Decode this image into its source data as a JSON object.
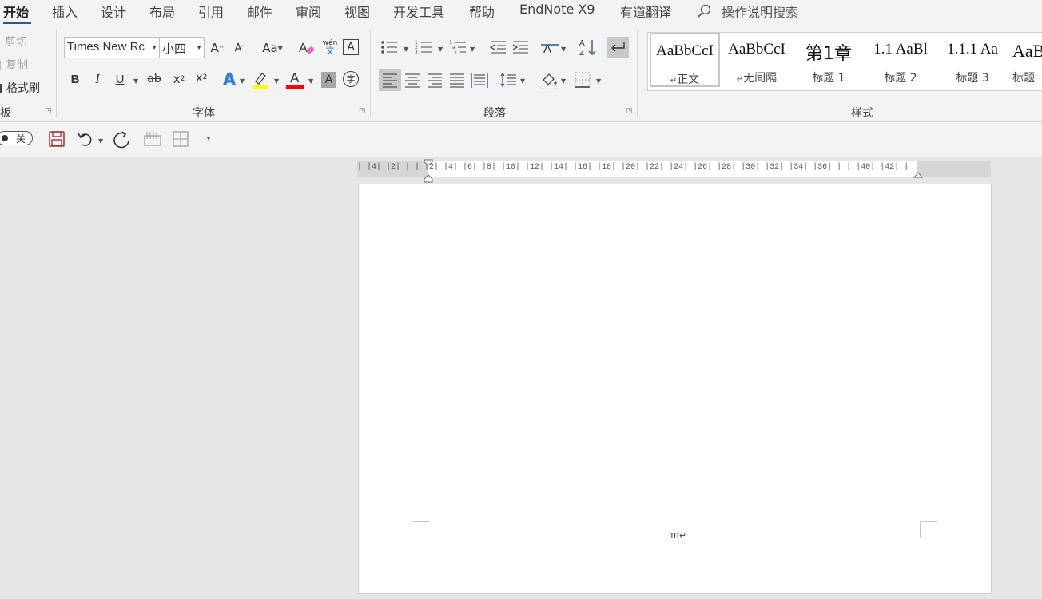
{
  "menu": {
    "tabs": [
      "开始",
      "插入",
      "设计",
      "布局",
      "引用",
      "邮件",
      "审阅",
      "视图",
      "开发工具",
      "帮助",
      "EndNote X9",
      "有道翻译"
    ],
    "search_label": "操作说明搜索"
  },
  "clipboard": {
    "cut": "剪切",
    "copy": "复制",
    "format_painter": "格式刷",
    "group_label": "板"
  },
  "font": {
    "name": "Times New Rc",
    "size": "小四",
    "grow": "A",
    "shrink": "A",
    "case": "Aa",
    "phonetic_top": "wén",
    "phonetic_bottom": "文",
    "bold": "B",
    "italic": "I",
    "underline": "U",
    "strike": "ab",
    "subscript": "x",
    "superscript": "x",
    "text_effects": "A",
    "font_color": "A",
    "char_shading": "A",
    "enclose": "字",
    "group_label": "字体",
    "highlight_color": "#ffff00",
    "font_color_value": "#ff0000"
  },
  "paragraph": {
    "group_label": "段落",
    "sort_label": "A Z"
  },
  "styles": {
    "group_label": "样式",
    "items": [
      {
        "preview": "AaBbCcI",
        "name": "正文",
        "mark": "↵"
      },
      {
        "preview": "AaBbCcI",
        "name": "无间隔",
        "mark": "↵"
      },
      {
        "preview": "第1章",
        "name": "标题 1",
        "mark": ""
      },
      {
        "preview": "1.1  AaBl",
        "name": "标题 2",
        "mark": ""
      },
      {
        "preview": "1.1.1  Aa",
        "name": "标题 3",
        "mark": ""
      },
      {
        "preview": "AaB",
        "name": "标题",
        "mark": ""
      }
    ]
  },
  "qat": {
    "toggle_label": "关"
  },
  "ruler": {
    "text": "| |4| |2| |   | |2| |4| |6| |8| |10| |12| |14| |16| |18| |20| |22| |24| |26| |28| |30| |32| |34| |36| |   | |40| |42| |"
  },
  "document": {
    "page_number_text": "III↵"
  }
}
